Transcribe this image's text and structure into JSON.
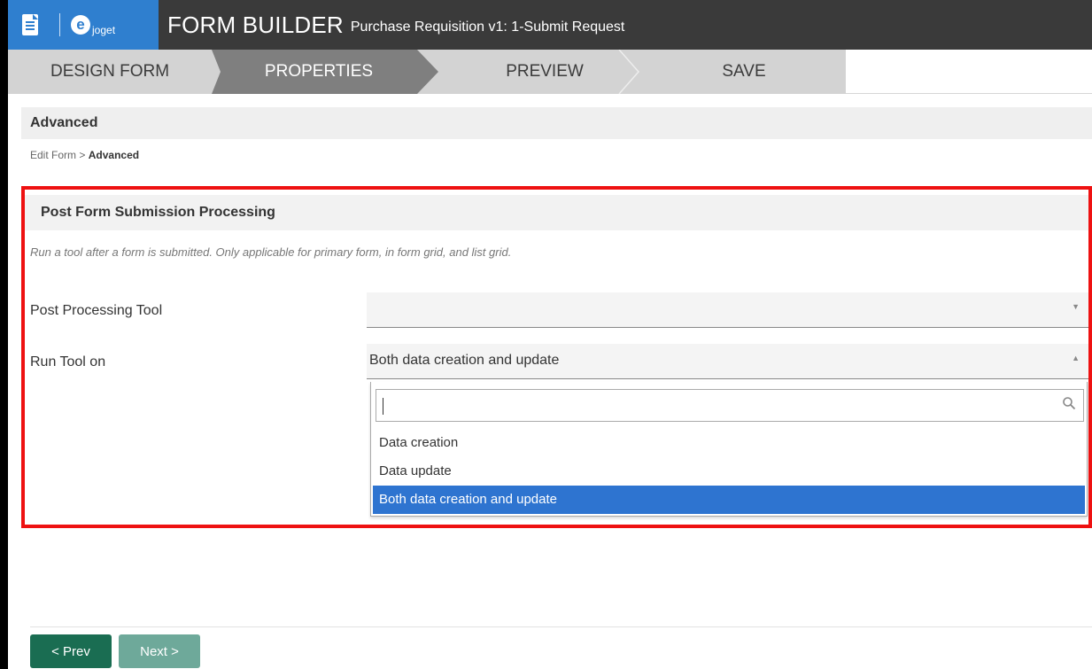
{
  "header": {
    "logo_text": "joget",
    "title": "FORM BUILDER",
    "subtitle": "Purchase Requisition v1: 1-Submit Request",
    "brand_color": "#2f7fcf"
  },
  "steps": [
    {
      "label": "DESIGN FORM",
      "active": false
    },
    {
      "label": "PROPERTIES",
      "active": true
    },
    {
      "label": "PREVIEW",
      "active": false
    },
    {
      "label": "SAVE",
      "active": false
    }
  ],
  "page": {
    "section_title": "Advanced",
    "breadcrumb_parent": "Edit Form",
    "breadcrumb_sep": ">",
    "breadcrumb_current": "Advanced"
  },
  "panel": {
    "title": "Post Form Submission Processing",
    "description": "Run a tool after a form is submitted. Only applicable for primary form, in form grid, and list grid.",
    "post_processing_label": "Post Processing Tool",
    "post_processing_value": "",
    "run_tool_label": "Run Tool on",
    "run_tool_value": "Both data creation and update",
    "search_value": "",
    "options": [
      "Data creation",
      "Data update",
      "Both data creation and update"
    ],
    "selected_index": 2,
    "highlight_color": "#ee1111"
  },
  "footer": {
    "prev_label": "< Prev",
    "next_label": "Next >"
  }
}
